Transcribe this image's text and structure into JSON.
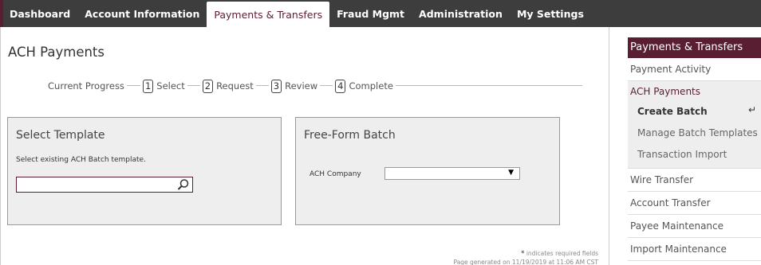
{
  "nav": {
    "tabs": [
      {
        "label": "Dashboard"
      },
      {
        "label": "Account Information"
      },
      {
        "label": "Payments & Transfers"
      },
      {
        "label": "Fraud Mgmt"
      },
      {
        "label": "Administration"
      },
      {
        "label": "My Settings"
      }
    ],
    "active_tab": "Payments & Transfers"
  },
  "page": {
    "title": "ACH Payments"
  },
  "progress": {
    "label": "Current Progress",
    "steps": [
      {
        "num": "1",
        "label": "Select"
      },
      {
        "num": "2",
        "label": "Request"
      },
      {
        "num": "3",
        "label": "Review"
      },
      {
        "num": "4",
        "label": "Complete"
      }
    ]
  },
  "select_template": {
    "title": "Select Template",
    "hint": "Select existing ACH Batch template.",
    "search_value": "",
    "search_icon": "search-icon"
  },
  "free_form": {
    "title": "Free-Form Batch",
    "company_label": "ACH Company",
    "company_value": ""
  },
  "footer": {
    "required_star": "*",
    "required_note": "indicates required fields",
    "generated": "Page generated on 11/19/2019 at 11:06 AM CST"
  },
  "sidebar": {
    "header": "Payments & Transfers",
    "items_top": [
      {
        "label": "Payment Activity"
      }
    ],
    "group": {
      "title": "ACH Payments",
      "items": [
        {
          "label": "Create Batch",
          "current": true,
          "indicator": "↵"
        },
        {
          "label": "Manage Batch Templates"
        },
        {
          "label": "Transaction Import"
        }
      ]
    },
    "items_bottom": [
      {
        "label": "Wire Transfer"
      },
      {
        "label": "Account Transfer"
      },
      {
        "label": "Payee Maintenance"
      },
      {
        "label": "Import Maintenance"
      }
    ]
  },
  "colors": {
    "brand": "#5a1e33",
    "nav_bg": "#3d3d3d",
    "panel_bg": "#eeeeee"
  }
}
